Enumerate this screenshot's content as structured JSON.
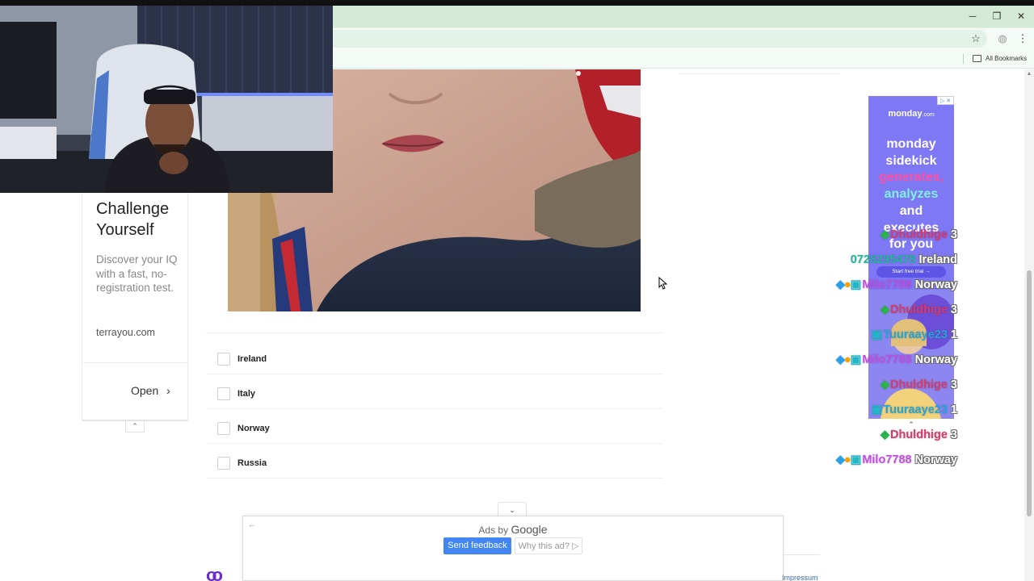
{
  "browser": {
    "window_controls": {
      "minimize": "─",
      "restore": "❐",
      "close": "✕"
    },
    "bookmarks_label": "All Bookmarks",
    "star_icon": "star-icon",
    "profile_icon": "profile-icon",
    "menu_icon": "kebab-menu-icon"
  },
  "quiz": {
    "options": [
      "Ireland",
      "Italy",
      "Norway",
      "Russia"
    ]
  },
  "sidebar_ad": {
    "title": "Challenge Yourself",
    "description": "Discover your IQ with a fast, no-registration test.",
    "site": "terrayou.com",
    "open_label": "Open",
    "chevron": "›",
    "collapse_glyph": "⌃"
  },
  "right_ad": {
    "brand": "monday",
    "brand_suffix": ".com",
    "lines": [
      {
        "text": "monday",
        "color": "#ffffff"
      },
      {
        "text": "sidekick",
        "color": "#ffffff"
      },
      {
        "text": "generates,",
        "color": "#ff4fa3"
      },
      {
        "text": "analyzes",
        "color": "#7ff0e0"
      },
      {
        "text": "and",
        "color": "#ffffff"
      },
      {
        "text": "executes",
        "color": "#ffffff"
      },
      {
        "text": "for you",
        "color": "#ffffff"
      }
    ],
    "cta": "Start free trial →",
    "badge": "▷ ✕",
    "collapse_glyph": "⌃"
  },
  "chat": [
    {
      "badges": "◆",
      "badge_colors": [
        "#29b34a"
      ],
      "user": "Dhuldhige",
      "user_color": "#d8396a",
      "msg": "3"
    },
    {
      "badges": "",
      "badge_colors": [],
      "user": "0726295478",
      "user_color": "#1fb89a",
      "msg": "Ireland"
    },
    {
      "badges": "◆●▣",
      "badge_colors": [
        "#2aa0e8",
        "#f0a400",
        "#1fb8c8"
      ],
      "user": "Milo7788",
      "user_color": "#c24de3",
      "msg": "Norway"
    },
    {
      "badges": "◆",
      "badge_colors": [
        "#29b34a"
      ],
      "user": "Dhuldhige",
      "user_color": "#d8396a",
      "msg": "3"
    },
    {
      "badges": "▣",
      "badge_colors": [
        "#1fb8c8"
      ],
      "user": "Tuuraaye23",
      "user_color": "#22a6d8",
      "msg": "1"
    },
    {
      "badges": "◆●▣",
      "badge_colors": [
        "#2aa0e8",
        "#f0a400",
        "#1fb8c8"
      ],
      "user": "Milo7788",
      "user_color": "#c24de3",
      "msg": "Norway"
    },
    {
      "badges": "◆",
      "badge_colors": [
        "#29b34a"
      ],
      "user": "Dhuldhige",
      "user_color": "#d8396a",
      "msg": "3"
    },
    {
      "badges": "▣",
      "badge_colors": [
        "#1fb8c8"
      ],
      "user": "Tuuraaye23",
      "user_color": "#22a6d8",
      "msg": "1"
    },
    {
      "badges": "◆",
      "badge_colors": [
        "#29b34a"
      ],
      "user": "Dhuldhige",
      "user_color": "#d8396a",
      "msg": "3"
    },
    {
      "badges": "◆●▣",
      "badge_colors": [
        "#2aa0e8",
        "#f0a400",
        "#1fb8c8"
      ],
      "user": "Milo7788",
      "user_color": "#c24de3",
      "msg": "Norway"
    }
  ],
  "bottom_ad": {
    "ads_by": "Ads by",
    "google": "Google",
    "send_feedback": "Send feedback",
    "why_this_ad": "Why this ad? ▷",
    "back_glyph": "←",
    "toggle_glyph": "⌄"
  },
  "footer": {
    "logo_glyph": "oo",
    "impressum": "Impressum"
  }
}
